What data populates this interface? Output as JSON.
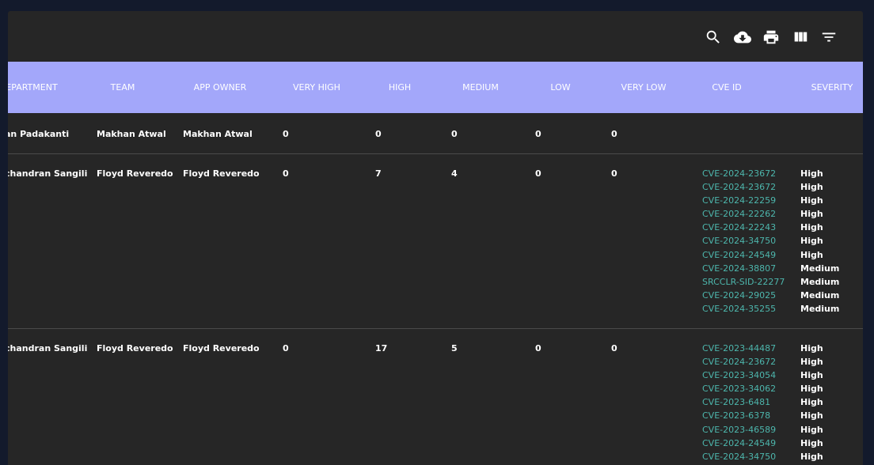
{
  "toolbar": {
    "icons": [
      "search-icon",
      "cloud-download-icon",
      "print-icon",
      "view-column-icon",
      "filter-list-icon"
    ]
  },
  "columns": [
    "EPARTMENT",
    "TEAM",
    "APP OWNER",
    "VERY HIGH",
    "HIGH",
    "MEDIUM",
    "LOW",
    "VERY LOW",
    "CVE ID",
    "SEVERITY"
  ],
  "rows": [
    {
      "department": "an Padakanti",
      "team": "Makhan Atwal",
      "app_owner": "Makhan Atwal",
      "very_high": "0",
      "high": "0",
      "medium": "0",
      "low": "0",
      "very_low": "0",
      "cves": []
    },
    {
      "department": "chandran Sangili",
      "team": "Floyd Reveredo",
      "app_owner": "Floyd Reveredo",
      "very_high": "0",
      "high": "7",
      "medium": "4",
      "low": "0",
      "very_low": "0",
      "cves": [
        {
          "id": "CVE-2024-23672",
          "severity": "High"
        },
        {
          "id": "CVE-2024-23672",
          "severity": "High"
        },
        {
          "id": "CVE-2024-22259",
          "severity": "High"
        },
        {
          "id": "CVE-2024-22262",
          "severity": "High"
        },
        {
          "id": "CVE-2024-22243",
          "severity": "High"
        },
        {
          "id": "CVE-2024-34750",
          "severity": "High"
        },
        {
          "id": "CVE-2024-24549",
          "severity": "High"
        },
        {
          "id": "CVE-2024-38807",
          "severity": "Medium"
        },
        {
          "id": "SRCCLR-SID-22277",
          "severity": "Medium"
        },
        {
          "id": "CVE-2024-29025",
          "severity": "Medium"
        },
        {
          "id": "CVE-2024-35255",
          "severity": "Medium"
        }
      ]
    },
    {
      "department": "chandran Sangili",
      "team": "Floyd Reveredo",
      "app_owner": "Floyd Reveredo",
      "very_high": "0",
      "high": "17",
      "medium": "5",
      "low": "0",
      "very_low": "0",
      "cves": [
        {
          "id": "CVE-2023-44487",
          "severity": "High"
        },
        {
          "id": "CVE-2024-23672",
          "severity": "High"
        },
        {
          "id": "CVE-2023-34054",
          "severity": "High"
        },
        {
          "id": "CVE-2023-34062",
          "severity": "High"
        },
        {
          "id": "CVE-2023-6481",
          "severity": "High"
        },
        {
          "id": "CVE-2023-6378",
          "severity": "High"
        },
        {
          "id": "CVE-2023-46589",
          "severity": "High"
        },
        {
          "id": "CVE-2024-24549",
          "severity": "High"
        },
        {
          "id": "CVE-2024-34750",
          "severity": "High"
        }
      ]
    }
  ]
}
